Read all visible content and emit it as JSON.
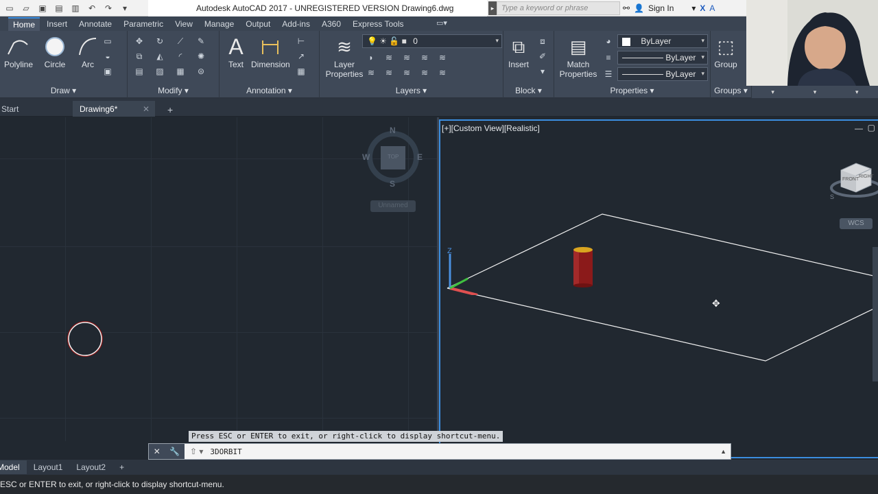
{
  "titlebar": {
    "title": "Autodesk AutoCAD 2017 - UNREGISTERED VERSION    Drawing6.dwg",
    "search_placeholder": "Type a keyword or phrase",
    "signin_label": "Sign In"
  },
  "ribbon_tabs": [
    "Home",
    "Insert",
    "Annotate",
    "Parametric",
    "View",
    "Manage",
    "Output",
    "Add-ins",
    "A360",
    "Express Tools"
  ],
  "panels": {
    "draw": {
      "title": "Draw",
      "polyline": "Polyline",
      "circle": "Circle",
      "arc": "Arc"
    },
    "modify": {
      "title": "Modify"
    },
    "annotation": {
      "title": "Annotation",
      "text": "Text",
      "dimension": "Dimension"
    },
    "layers": {
      "title": "Layers",
      "layer_properties": "Layer Properties",
      "current_layer": "0"
    },
    "block": {
      "title": "Block",
      "insert": "Insert"
    },
    "properties": {
      "title": "Properties",
      "match_properties": "Match Properties",
      "color": "ByLayer",
      "linetype": "ByLayer",
      "lineweight": "ByLayer"
    },
    "groups": {
      "title": "Groups",
      "group": "Group"
    }
  },
  "doc_tabs": {
    "start": "Start",
    "drawing": "Drawing6*",
    "add": "+"
  },
  "left_viewport": {
    "compass": {
      "n": "N",
      "s": "S",
      "e": "E",
      "w": "W",
      "top": "TOP",
      "unnamed": "Unnamed"
    }
  },
  "right_viewport": {
    "label": "[+][Custom View][Realistic]",
    "wcs": "WCS",
    "viewcube": {
      "front": "FRONT",
      "right": "RIGHT",
      "s": "S"
    },
    "axis_z": "Z"
  },
  "command": {
    "message": "Press ESC or ENTER to exit, or right-click to display shortcut-menu.",
    "input": "3DORBIT"
  },
  "layout_tabs": [
    "Model",
    "Layout1",
    "Layout2",
    "+"
  ],
  "status_text": "ESC or ENTER to exit, or right-click to display shortcut-menu.",
  "colors": {
    "accent": "#3b8ee0",
    "cylinder": "#8b1a1a",
    "cylinder_top": "#d9a520",
    "axis_x": "#e05050",
    "axis_y": "#40c040",
    "axis_z": "#4a90e0"
  }
}
